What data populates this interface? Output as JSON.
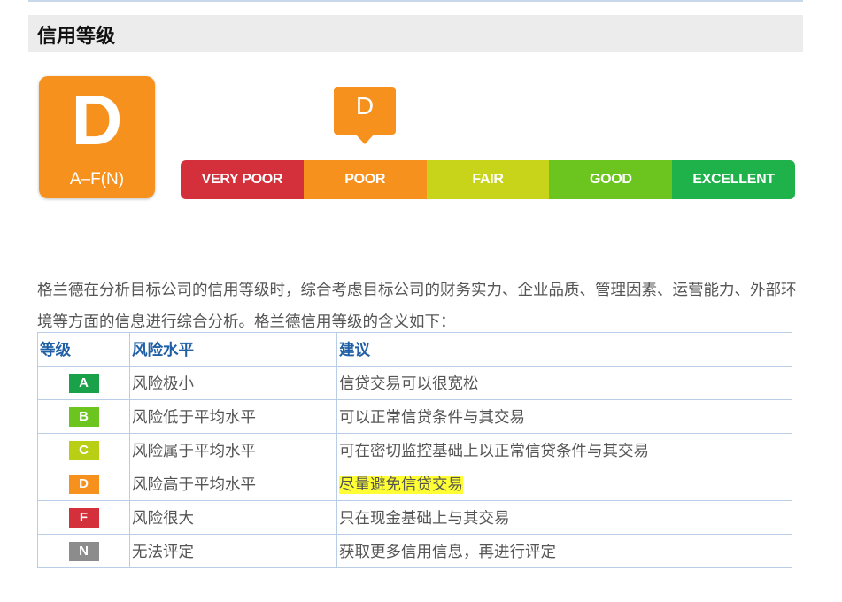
{
  "header": {
    "title": "信用等级"
  },
  "grade": {
    "letter": "D",
    "range": "A–F(N)",
    "color": "#f7911e"
  },
  "pointer": {
    "letter": "D"
  },
  "scale": [
    {
      "label": "VERY POOR",
      "color": "#d3303c"
    },
    {
      "label": "POOR",
      "color": "#f7911e"
    },
    {
      "label": "FAIR",
      "color": "#c8d41a"
    },
    {
      "label": "GOOD",
      "color": "#6cc51f"
    },
    {
      "label": "EXCELLENT",
      "color": "#20b24a"
    }
  ],
  "paragraph": "格兰德在分析目标公司的信用等级时，综合考虑目标公司的财务实力、企业品质、管理因素、运营能力、外部环境等方面的信息进行综合分析。格兰德信用等级的含义如下：",
  "table": {
    "headers": [
      "等级",
      "风险水平",
      "建议"
    ],
    "rows": [
      {
        "grade": "A",
        "color": "#1aa24a",
        "risk": "风险极小",
        "advice": "信贷交易可以很宽松",
        "highlight": false
      },
      {
        "grade": "B",
        "color": "#6cc51f",
        "risk": "风险低于平均水平",
        "advice": "可以正常信贷条件与其交易",
        "highlight": false
      },
      {
        "grade": "C",
        "color": "#b9cf16",
        "risk": "风险属于平均水平",
        "advice": "可在密切监控基础上以正常信贷条件与其交易",
        "highlight": false
      },
      {
        "grade": "D",
        "color": "#f7911e",
        "risk": "风险高于平均水平",
        "advice": "尽量避免信贷交易",
        "highlight": true
      },
      {
        "grade": "F",
        "color": "#d3303c",
        "risk": "风险很大",
        "advice": "只在现金基础上与其交易",
        "highlight": false
      },
      {
        "grade": "N",
        "color": "#8c8c8c",
        "risk": "无法评定",
        "advice": "获取更多信用信息，再进行评定",
        "highlight": false
      }
    ]
  }
}
